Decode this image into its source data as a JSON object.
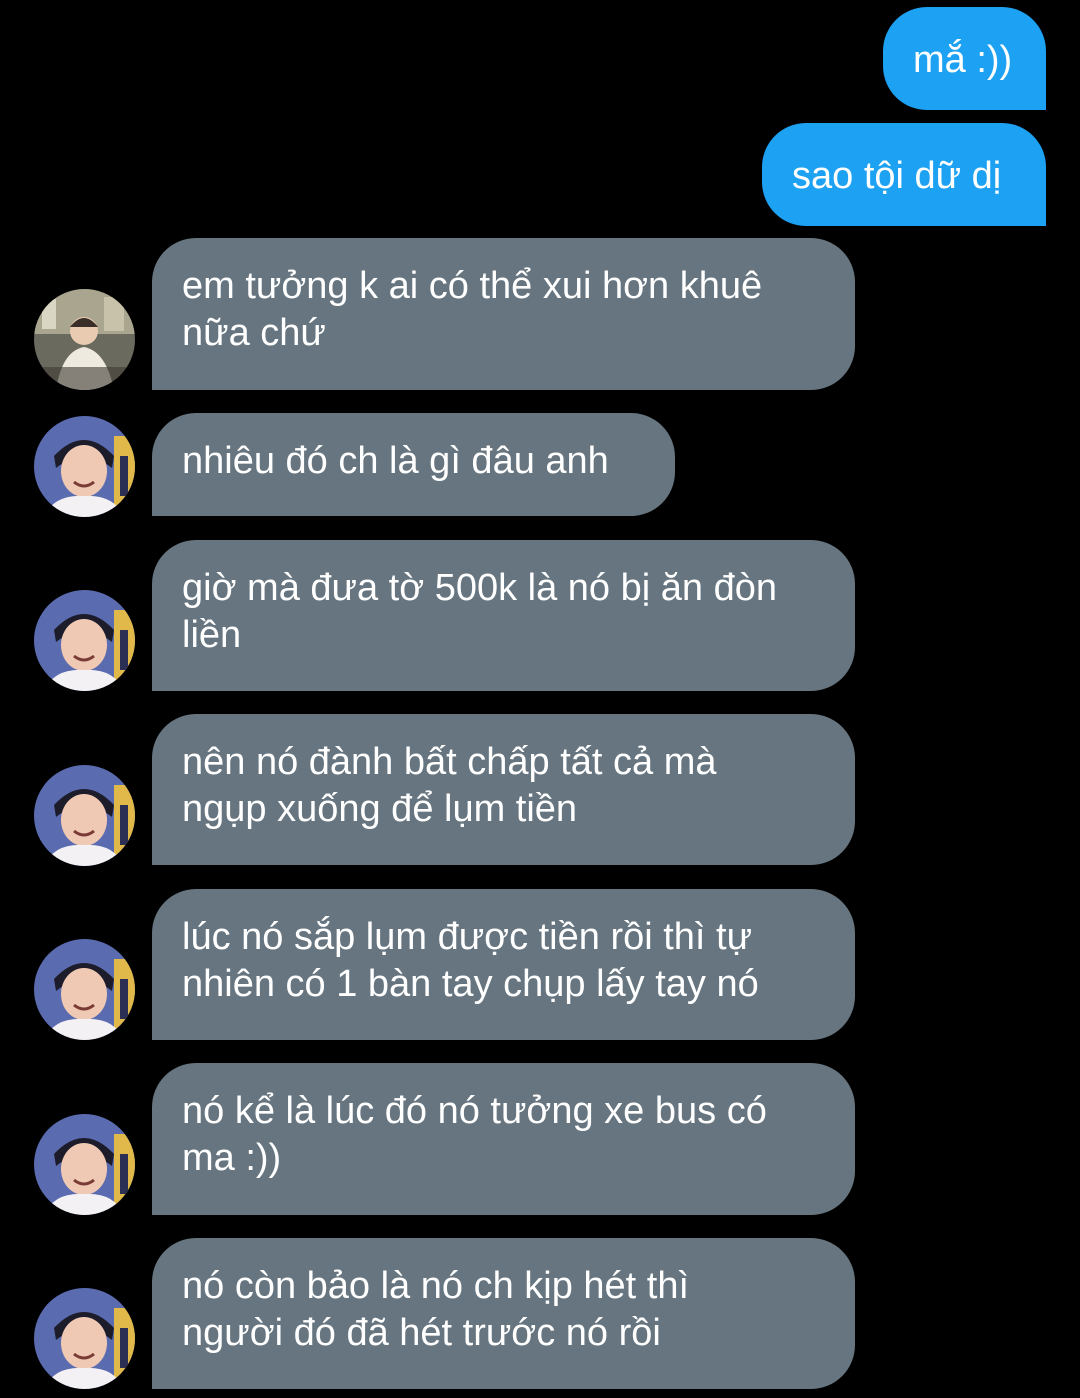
{
  "conversation": {
    "sent": [
      {
        "text": "mắ :))"
      },
      {
        "text": "sao tội dữ dị"
      }
    ],
    "received": [
      {
        "text": "em tưởng k ai có thể xui hơn khuê\nnữa chứ",
        "avatar": "avatar-photo-cafe"
      },
      {
        "text": "nhiêu đó ch là gì đâu anh",
        "avatar": "avatar-photo-smiling"
      },
      {
        "text": "giờ mà đưa tờ 500k là nó bị ăn đòn\nliền",
        "avatar": "avatar-photo-smiling"
      },
      {
        "text": "nên nó đành bất chấp tất cả mà\nngụp xuống để lụm tiền",
        "avatar": "avatar-photo-smiling"
      },
      {
        "text": "lúc nó sắp lụm được tiền rồi thì tự\nnhiên có 1 bàn tay chụp lấy tay nó",
        "avatar": "avatar-photo-smiling"
      },
      {
        "text": "nó kể là lúc đó nó tưởng xe bus có\nma :))",
        "avatar": "avatar-photo-smiling"
      },
      {
        "text": "nó còn bảo là nó ch kịp hét thì\nngười đó đã hét trước nó rồi",
        "avatar": "avatar-photo-smiling"
      }
    ]
  },
  "colors": {
    "background": "#000000",
    "sent_bubble": "#1da1f2",
    "received_bubble": "#66757f",
    "text": "#ffffff"
  }
}
